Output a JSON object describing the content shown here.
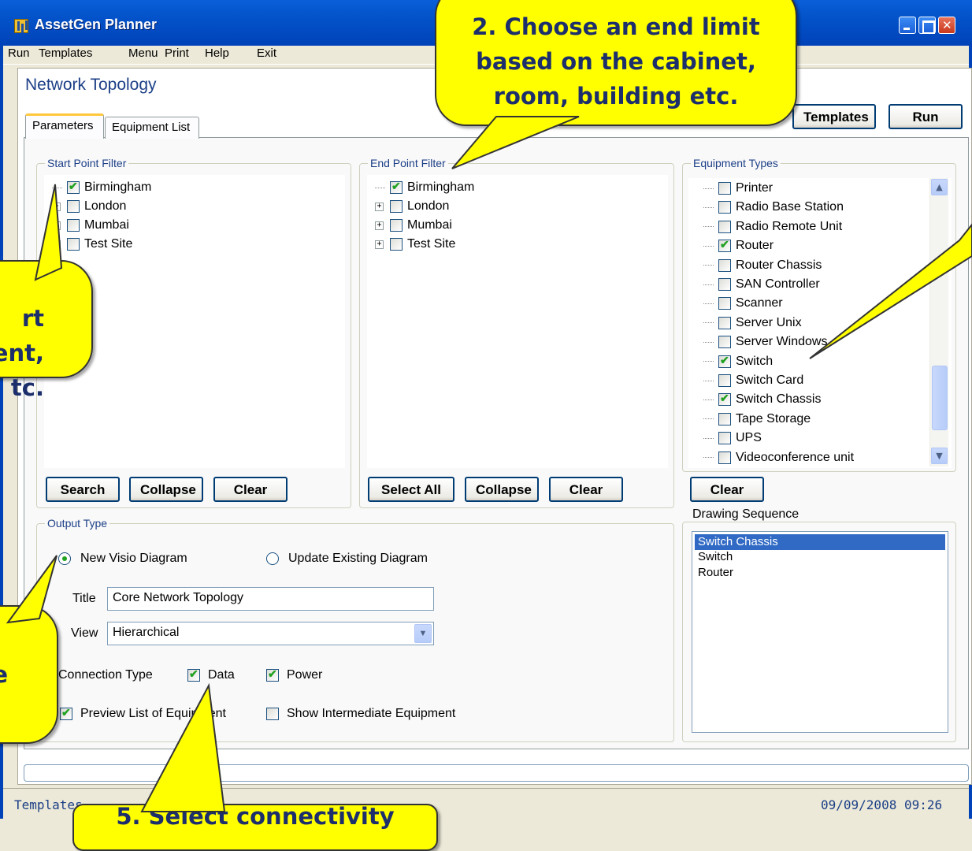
{
  "window": {
    "title": "AssetGen Planner"
  },
  "menu": [
    "Run",
    "Templates",
    "Menu",
    "Print",
    "Help",
    "Exit"
  ],
  "page_title": "Network Topology",
  "tabs": [
    {
      "label": "Parameters",
      "active": true
    },
    {
      "label": "Equipment List",
      "active": false
    }
  ],
  "top_buttons": {
    "templates": "Templates",
    "run": "Run"
  },
  "start_filter": {
    "legend": "Start Point Filter",
    "items": [
      {
        "label": "Birmingham",
        "checked": true,
        "expandable": false
      },
      {
        "label": "London",
        "checked": false,
        "expandable": true
      },
      {
        "label": "Mumbai",
        "checked": false,
        "expandable": true
      },
      {
        "label": "Test Site",
        "checked": false,
        "expandable": true
      }
    ],
    "buttons": {
      "search": "Search",
      "collapse": "Collapse",
      "clear": "Clear"
    }
  },
  "end_filter": {
    "legend": "End Point Filter",
    "items": [
      {
        "label": "Birmingham",
        "checked": true,
        "expandable": false
      },
      {
        "label": "London",
        "checked": false,
        "expandable": true
      },
      {
        "label": "Mumbai",
        "checked": false,
        "expandable": true
      },
      {
        "label": "Test Site",
        "checked": false,
        "expandable": true
      }
    ],
    "buttons": {
      "select_all": "Select All",
      "collapse": "Collapse",
      "clear": "Clear"
    }
  },
  "equipment_types": {
    "legend": "Equipment Types",
    "items": [
      {
        "label": "Printer",
        "checked": false
      },
      {
        "label": "Radio Base Station",
        "checked": false
      },
      {
        "label": "Radio Remote Unit",
        "checked": false
      },
      {
        "label": "Router",
        "checked": true
      },
      {
        "label": "Router Chassis",
        "checked": false
      },
      {
        "label": "SAN Controller",
        "checked": false
      },
      {
        "label": "Scanner",
        "checked": false
      },
      {
        "label": "Server Unix",
        "checked": false
      },
      {
        "label": "Server Windows",
        "checked": false
      },
      {
        "label": "Switch",
        "checked": true
      },
      {
        "label": "Switch Card",
        "checked": false
      },
      {
        "label": "Switch Chassis",
        "checked": true
      },
      {
        "label": "Tape Storage",
        "checked": false
      },
      {
        "label": "UPS",
        "checked": false
      },
      {
        "label": "Videoconference unit",
        "checked": false
      }
    ],
    "clear": "Clear"
  },
  "output_type": {
    "legend": "Output Type",
    "new_visio": {
      "label": "New Visio Diagram",
      "selected": true
    },
    "update_existing": {
      "label": "Update Existing Diagram",
      "selected": false
    },
    "title_label": "Title",
    "title_value": "Core Network Topology",
    "view_label": "View",
    "view_value": "Hierarchical",
    "connection_type_label": "Connection Type",
    "data": {
      "label": "Data",
      "checked": true
    },
    "power": {
      "label": "Power",
      "checked": true
    },
    "preview": {
      "label": "Preview List of Equipment",
      "checked": true
    },
    "intermediate": {
      "label": "Show Intermediate Equipment",
      "checked": false
    }
  },
  "drawing_sequence": {
    "label": "Drawing Sequence",
    "items": [
      {
        "label": "Switch Chassis",
        "selected": true
      },
      {
        "label": "Switch",
        "selected": false
      },
      {
        "label": "Router",
        "selected": false
      }
    ]
  },
  "status": {
    "left": "Templates",
    "datetime": "09/09/2008  09:26"
  },
  "callouts": {
    "c2": "2. Choose an end limit based on the cabinet, room, building etc.",
    "c1": "rt\nent,\ntc.",
    "c4": "e",
    "c5": "5. Select connectivity"
  },
  "colors": {
    "callout": "#ffff00",
    "titlebar": "#0352c9",
    "selection": "#316ac5",
    "check": "#21a121"
  }
}
